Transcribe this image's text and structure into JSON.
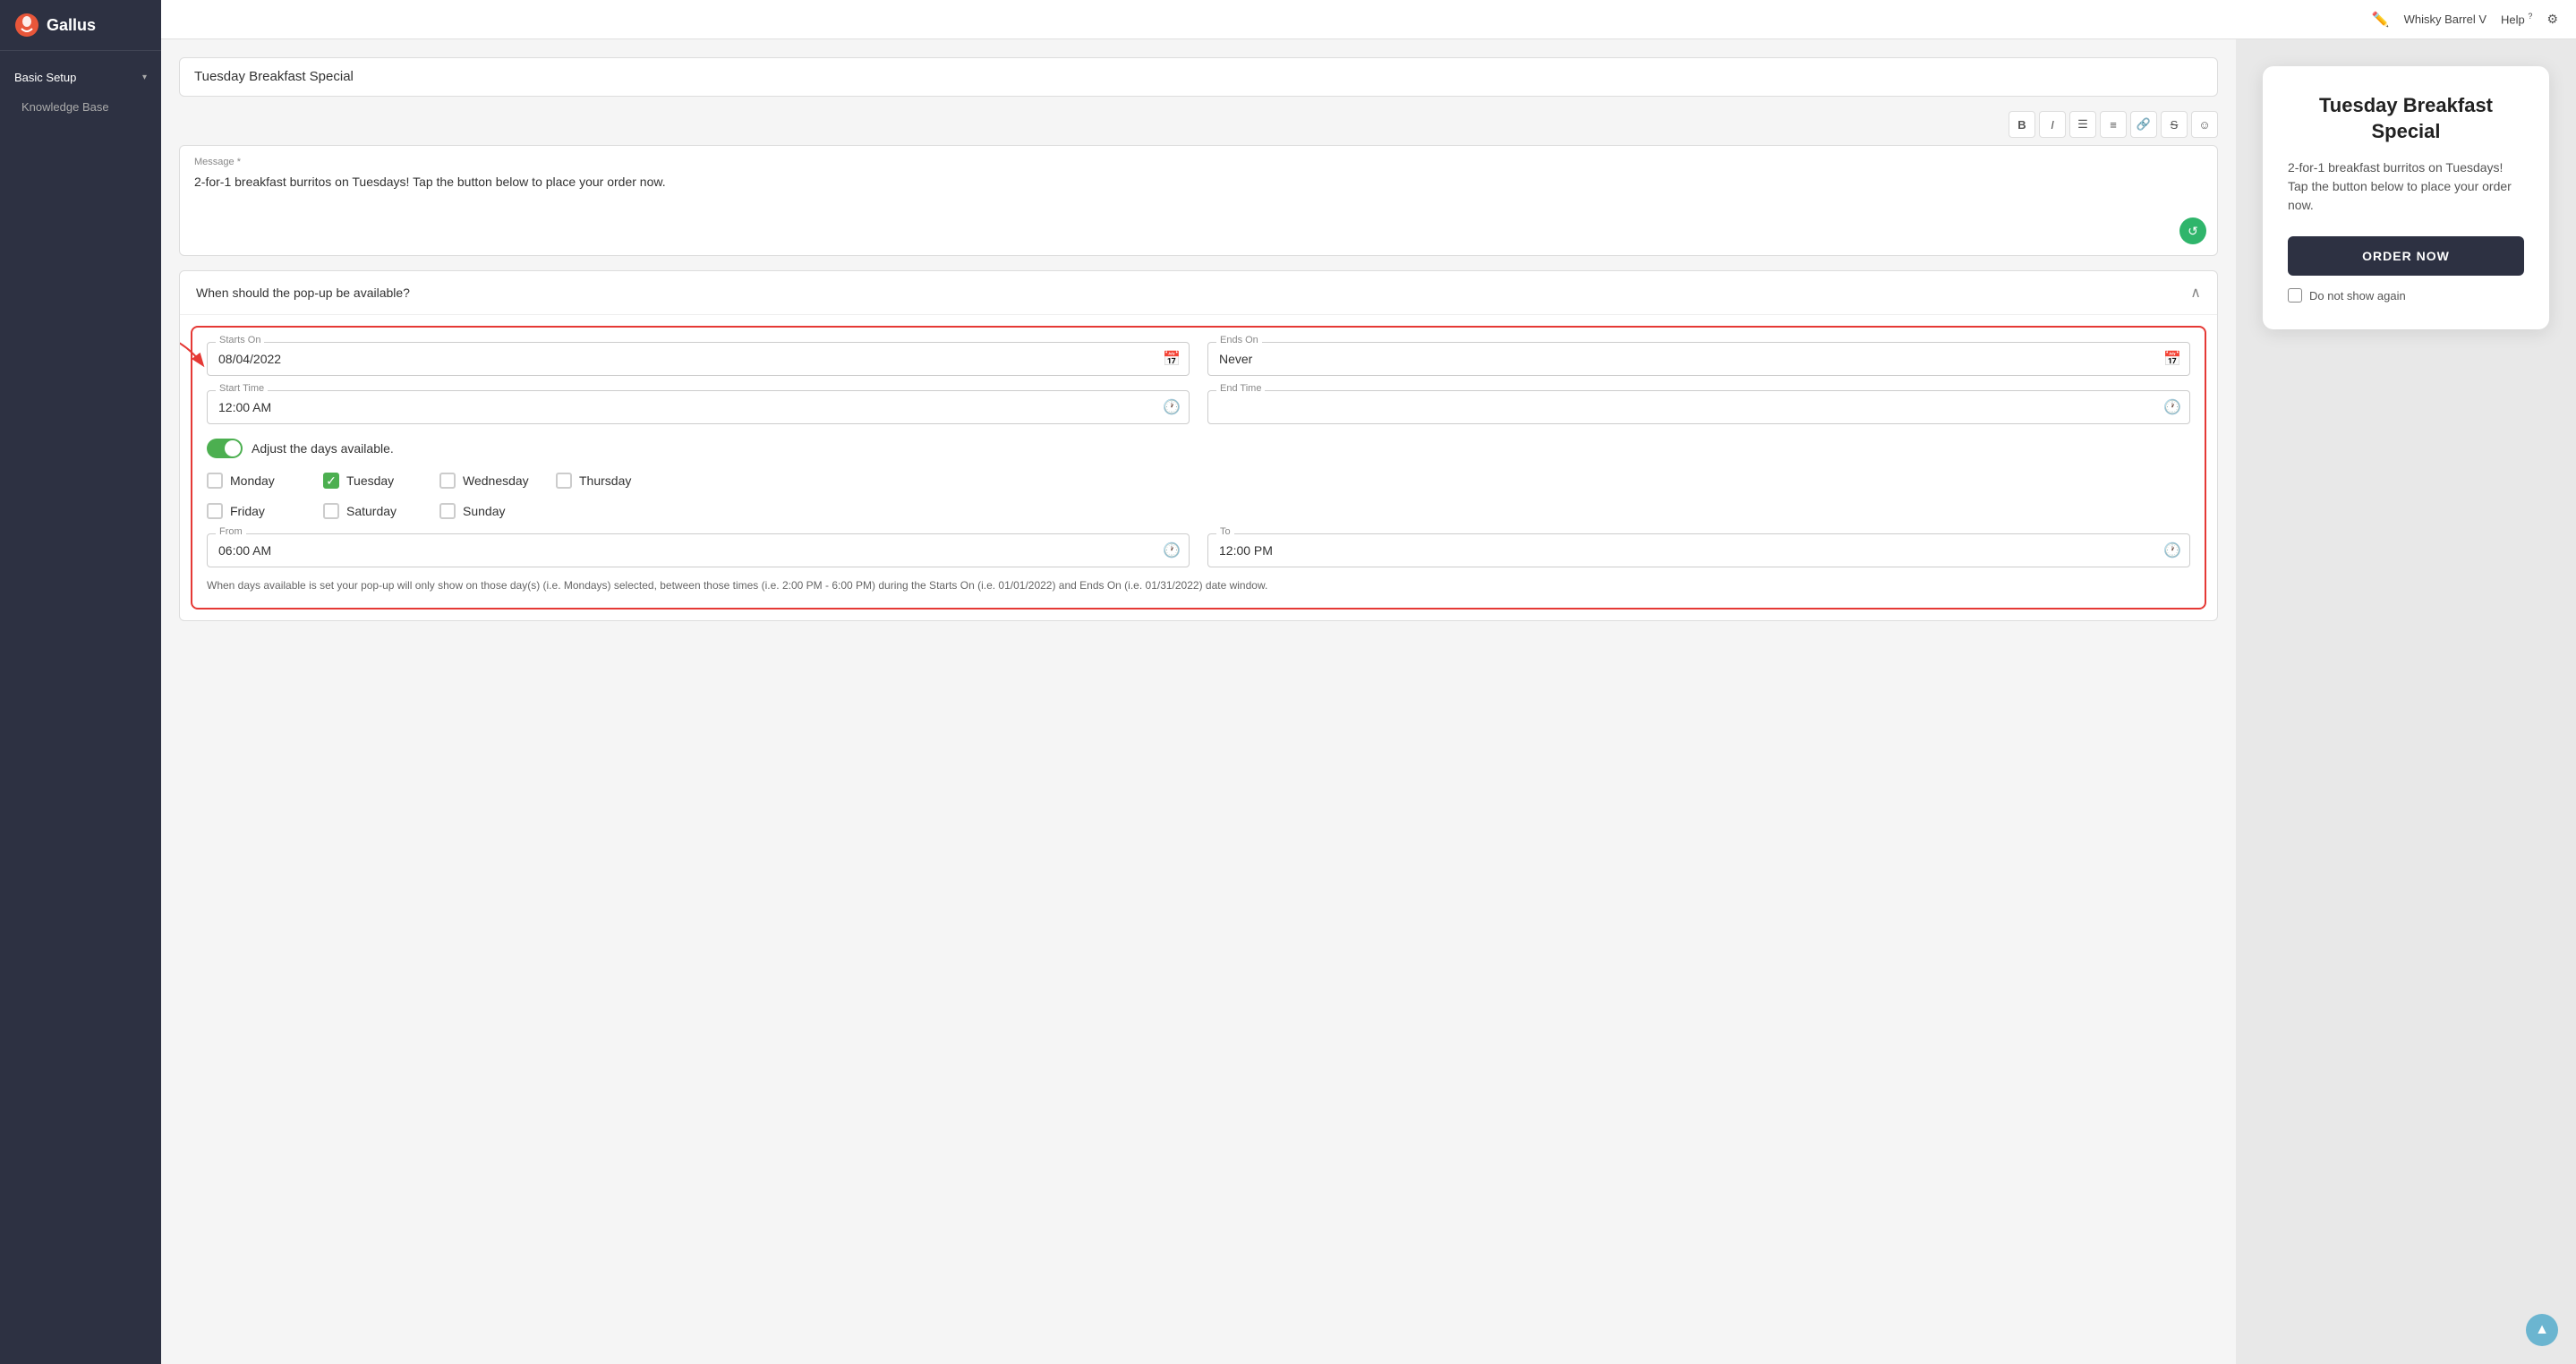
{
  "app": {
    "logo_text": "Gallus",
    "topbar_user": "Whisky Barrel V",
    "topbar_help": "Help",
    "topbar_help_icon": "?"
  },
  "sidebar": {
    "items": [
      {
        "label": "Basic Setup",
        "has_chevron": true,
        "active": true
      },
      {
        "label": "Knowledge Base",
        "has_chevron": false,
        "active": false
      }
    ]
  },
  "editor": {
    "title_value": "Tuesday Breakfast Special",
    "toolbar_buttons": [
      "B",
      "I",
      "≡",
      "≡",
      "🔗",
      "S",
      "☺"
    ],
    "message_label": "Message *",
    "message_text": "2-for-1 breakfast burritos on Tuesdays! Tap the button below to place your order now.",
    "availability_header": "When should the pop-up be available?"
  },
  "availability": {
    "starts_on_label": "Starts On",
    "starts_on_value": "08/04/2022",
    "ends_on_label": "Ends On",
    "ends_on_value": "Never",
    "start_time_label": "Start Time",
    "start_time_value": "12:00 AM",
    "end_time_label": "End Time",
    "end_time_placeholder": "",
    "toggle_label": "Adjust the days available.",
    "days": [
      {
        "label": "Monday",
        "checked": false
      },
      {
        "label": "Tuesday",
        "checked": true
      },
      {
        "label": "Wednesday",
        "checked": false
      },
      {
        "label": "Thursday",
        "checked": false
      },
      {
        "label": "Friday",
        "checked": false
      },
      {
        "label": "Saturday",
        "checked": false
      },
      {
        "label": "Sunday",
        "checked": false
      }
    ],
    "from_label": "From",
    "from_value": "06:00 AM",
    "to_label": "To",
    "to_value": "12:00 PM",
    "info_text": "When days available is set your pop-up will only show on those day(s) (i.e. Mondays) selected, between those times (i.e. 2:00 PM - 6:00 PM) during the Starts On (i.e. 01/01/2022) and Ends On (i.e. 01/31/2022) date window."
  },
  "preview": {
    "title": "Tuesday Breakfast Special",
    "message": "2-for-1 breakfast burritos on Tuesdays! Tap the button below to place your order now.",
    "order_button_label": "ORDER NOW",
    "do_not_show_label": "Do not show again"
  }
}
